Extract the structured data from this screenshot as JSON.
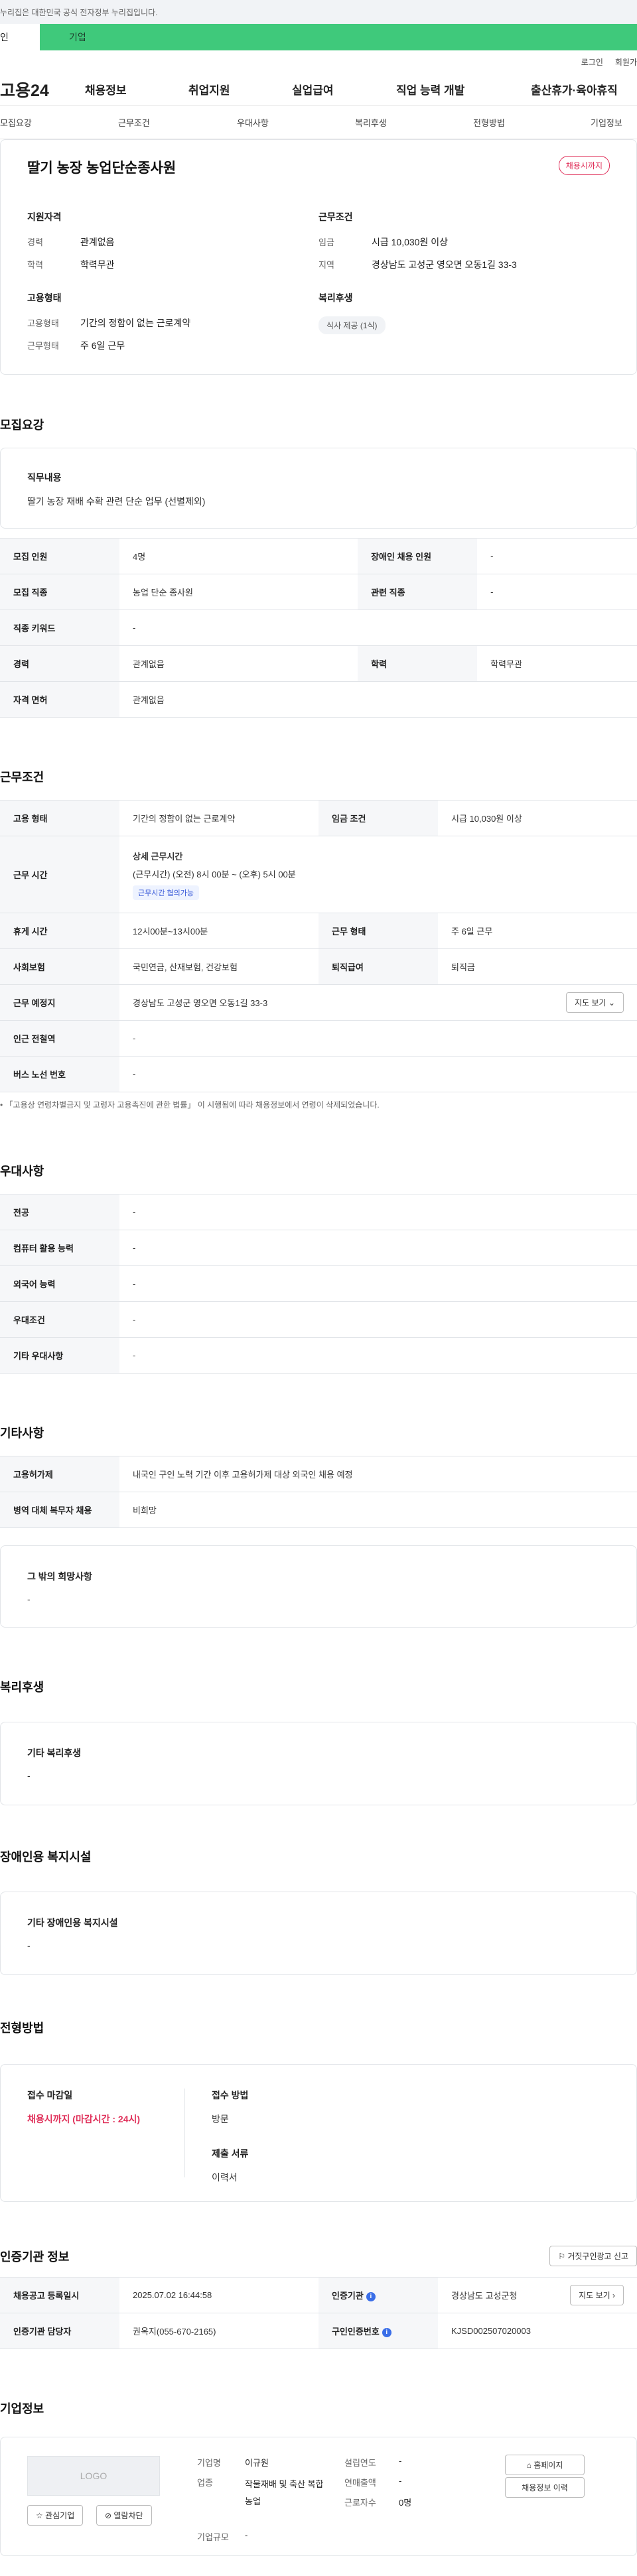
{
  "top_notice": "누리집은 대한민국 공식 전자정부 누리집입니다.",
  "tabs": {
    "person": "인",
    "company": "기업"
  },
  "util": {
    "login": "로그인",
    "join": "회원가"
  },
  "gnb": {
    "logo": "고용24",
    "items": [
      "채용정보",
      "취업지원",
      "실업급여",
      "직업 능력 개발",
      "출산휴가·육아휴직"
    ]
  },
  "anchor_nav": [
    "모집요강",
    "근무조건",
    "우대사항",
    "복리후생",
    "전형방법",
    "기업정보"
  ],
  "hero": {
    "title": "딸기 농장 농업단순종사원",
    "status_badge": "채용시까지",
    "qual_title": "지원자격",
    "career_label": "경력",
    "career_value": "관계없음",
    "edu_label": "학력",
    "edu_value": "학력무관",
    "cond_title": "근무조건",
    "wage_label": "임금",
    "wage_value": "시급 10,030원 이상",
    "region_label": "지역",
    "region_value": "경상남도 고성군 영오면 오동1길 33-3",
    "emptype_title": "고용형태",
    "emptype_label": "고용형태",
    "emptype_value": "기간의 정함이 없는 근로계약",
    "worktype_label": "근무형태",
    "worktype_value": "주 6일 근무",
    "welfare_title": "복리후생",
    "welfare_chip": "식사 제공 (1식)"
  },
  "recruit": {
    "title": "모집요강",
    "job_content_label": "직무내용",
    "job_content_value": "딸기 농장 재배 수확 관련 단순 업무 (선별제외)",
    "rows": [
      [
        "모집 인원",
        "4명",
        "장애인 채용 인원",
        "-"
      ],
      [
        "모집 직종",
        "농업 단순 종사원",
        "관련 직종",
        "-"
      ],
      [
        "직종 키워드",
        "-"
      ],
      [
        "경력",
        "관계없음",
        "학력",
        "학력무관"
      ],
      [
        "자격 면허",
        "관계없음"
      ]
    ]
  },
  "conditions": {
    "title": "근무조건",
    "emptype_label": "고용 형태",
    "emptype_value": "기간의 정함이 없는 근로계약",
    "wage_label": "임금 조건",
    "wage_value": "시급 10,030원 이상",
    "hours_label": "근무 시간",
    "hours_detail_title": "상세 근무시간",
    "hours_detail_value": "(근무시간) (오전) 8시 00분 ~ (오후) 5시 00분",
    "hours_badge": "근무시간 협의가능",
    "break_label": "휴게 시간",
    "break_value": "12시00분~13시00분",
    "worktype_label": "근무 형태",
    "worktype_value": "주 6일 근무",
    "insurance_label": "사회보험",
    "insurance_value": "국민연금, 산재보험, 건강보험",
    "retire_label": "퇴직급여",
    "retire_value": "퇴직금",
    "place_label": "근무 예정지",
    "place_value": "경상남도 고성군 영오면 오동1길 33-3",
    "map_button": "지도 보기",
    "subway_label": "인근 전철역",
    "subway_value": "-",
    "bus_label": "버스 노선 번호",
    "bus_value": "-",
    "note": "「고용상 연령차별금지 및 고령자 고용촉진에 관한 법률」 이 시행됨에 따라 채용정보에서 연령이 삭제되었습니다."
  },
  "preference": {
    "title": "우대사항",
    "rows": [
      [
        "전공",
        "-"
      ],
      [
        "컴퓨터 활용 능력",
        "-"
      ],
      [
        "외국어 능력",
        "-"
      ],
      [
        "우대조건",
        "-"
      ],
      [
        "기타 우대사항",
        "-"
      ]
    ]
  },
  "etc": {
    "title": "기타사항",
    "rows": [
      [
        "고용허가제",
        "내국인 구인 노력 기간 이후 고용허가제 대상 외국인 채용 예정"
      ],
      [
        "병역 대체 복무자 채용",
        "비희망"
      ]
    ],
    "other_label": "그 밖의 희망사항",
    "other_value": "-"
  },
  "welfare": {
    "title": "복리후생",
    "label": "기타 복리후생",
    "value": "-"
  },
  "disability": {
    "title": "장애인용 복지시설",
    "label": "기타 장애인용 복지시설",
    "value": "-"
  },
  "selection": {
    "title": "전형방법",
    "deadline_label": "접수 마감일",
    "deadline_value": "채용시까지 (마감시간 : 24시)",
    "method_label": "접수 방법",
    "method_value": "방문",
    "docs_label": "제출 서류",
    "docs_value": "이력서"
  },
  "agency": {
    "title": "인증기관 정보",
    "report_button": "거짓구인광고 신고",
    "reg_date_label": "채용공고 등록일시",
    "reg_date_value": "2025.07.02 16:44:58",
    "agency_label": "인증기관",
    "agency_value": "경상남도 고성군청",
    "map_button": "지도 보기",
    "manager_label": "인증기관 담당자",
    "manager_value": "권옥지(055-670-2165)",
    "cert_label": "구인인증번호",
    "cert_value": "KJSD002507020003"
  },
  "company": {
    "title": "기업정보",
    "logo_placeholder": "LOGO",
    "fav_button": "관심기업",
    "block_button": "열람차단",
    "name_label": "기업명",
    "name_value": "이규원",
    "industry_label": "업종",
    "industry_value": "작물재배 및 축산 복합농업",
    "size_label": "기업규모",
    "size_value": "-",
    "founded_label": "설립연도",
    "founded_value": "-",
    "sales_label": "연매출액",
    "sales_value": "-",
    "staff_label": "근로자수",
    "staff_value": "0명",
    "homepage_button": "홈페이지",
    "history_button": "채용정보 이력"
  }
}
